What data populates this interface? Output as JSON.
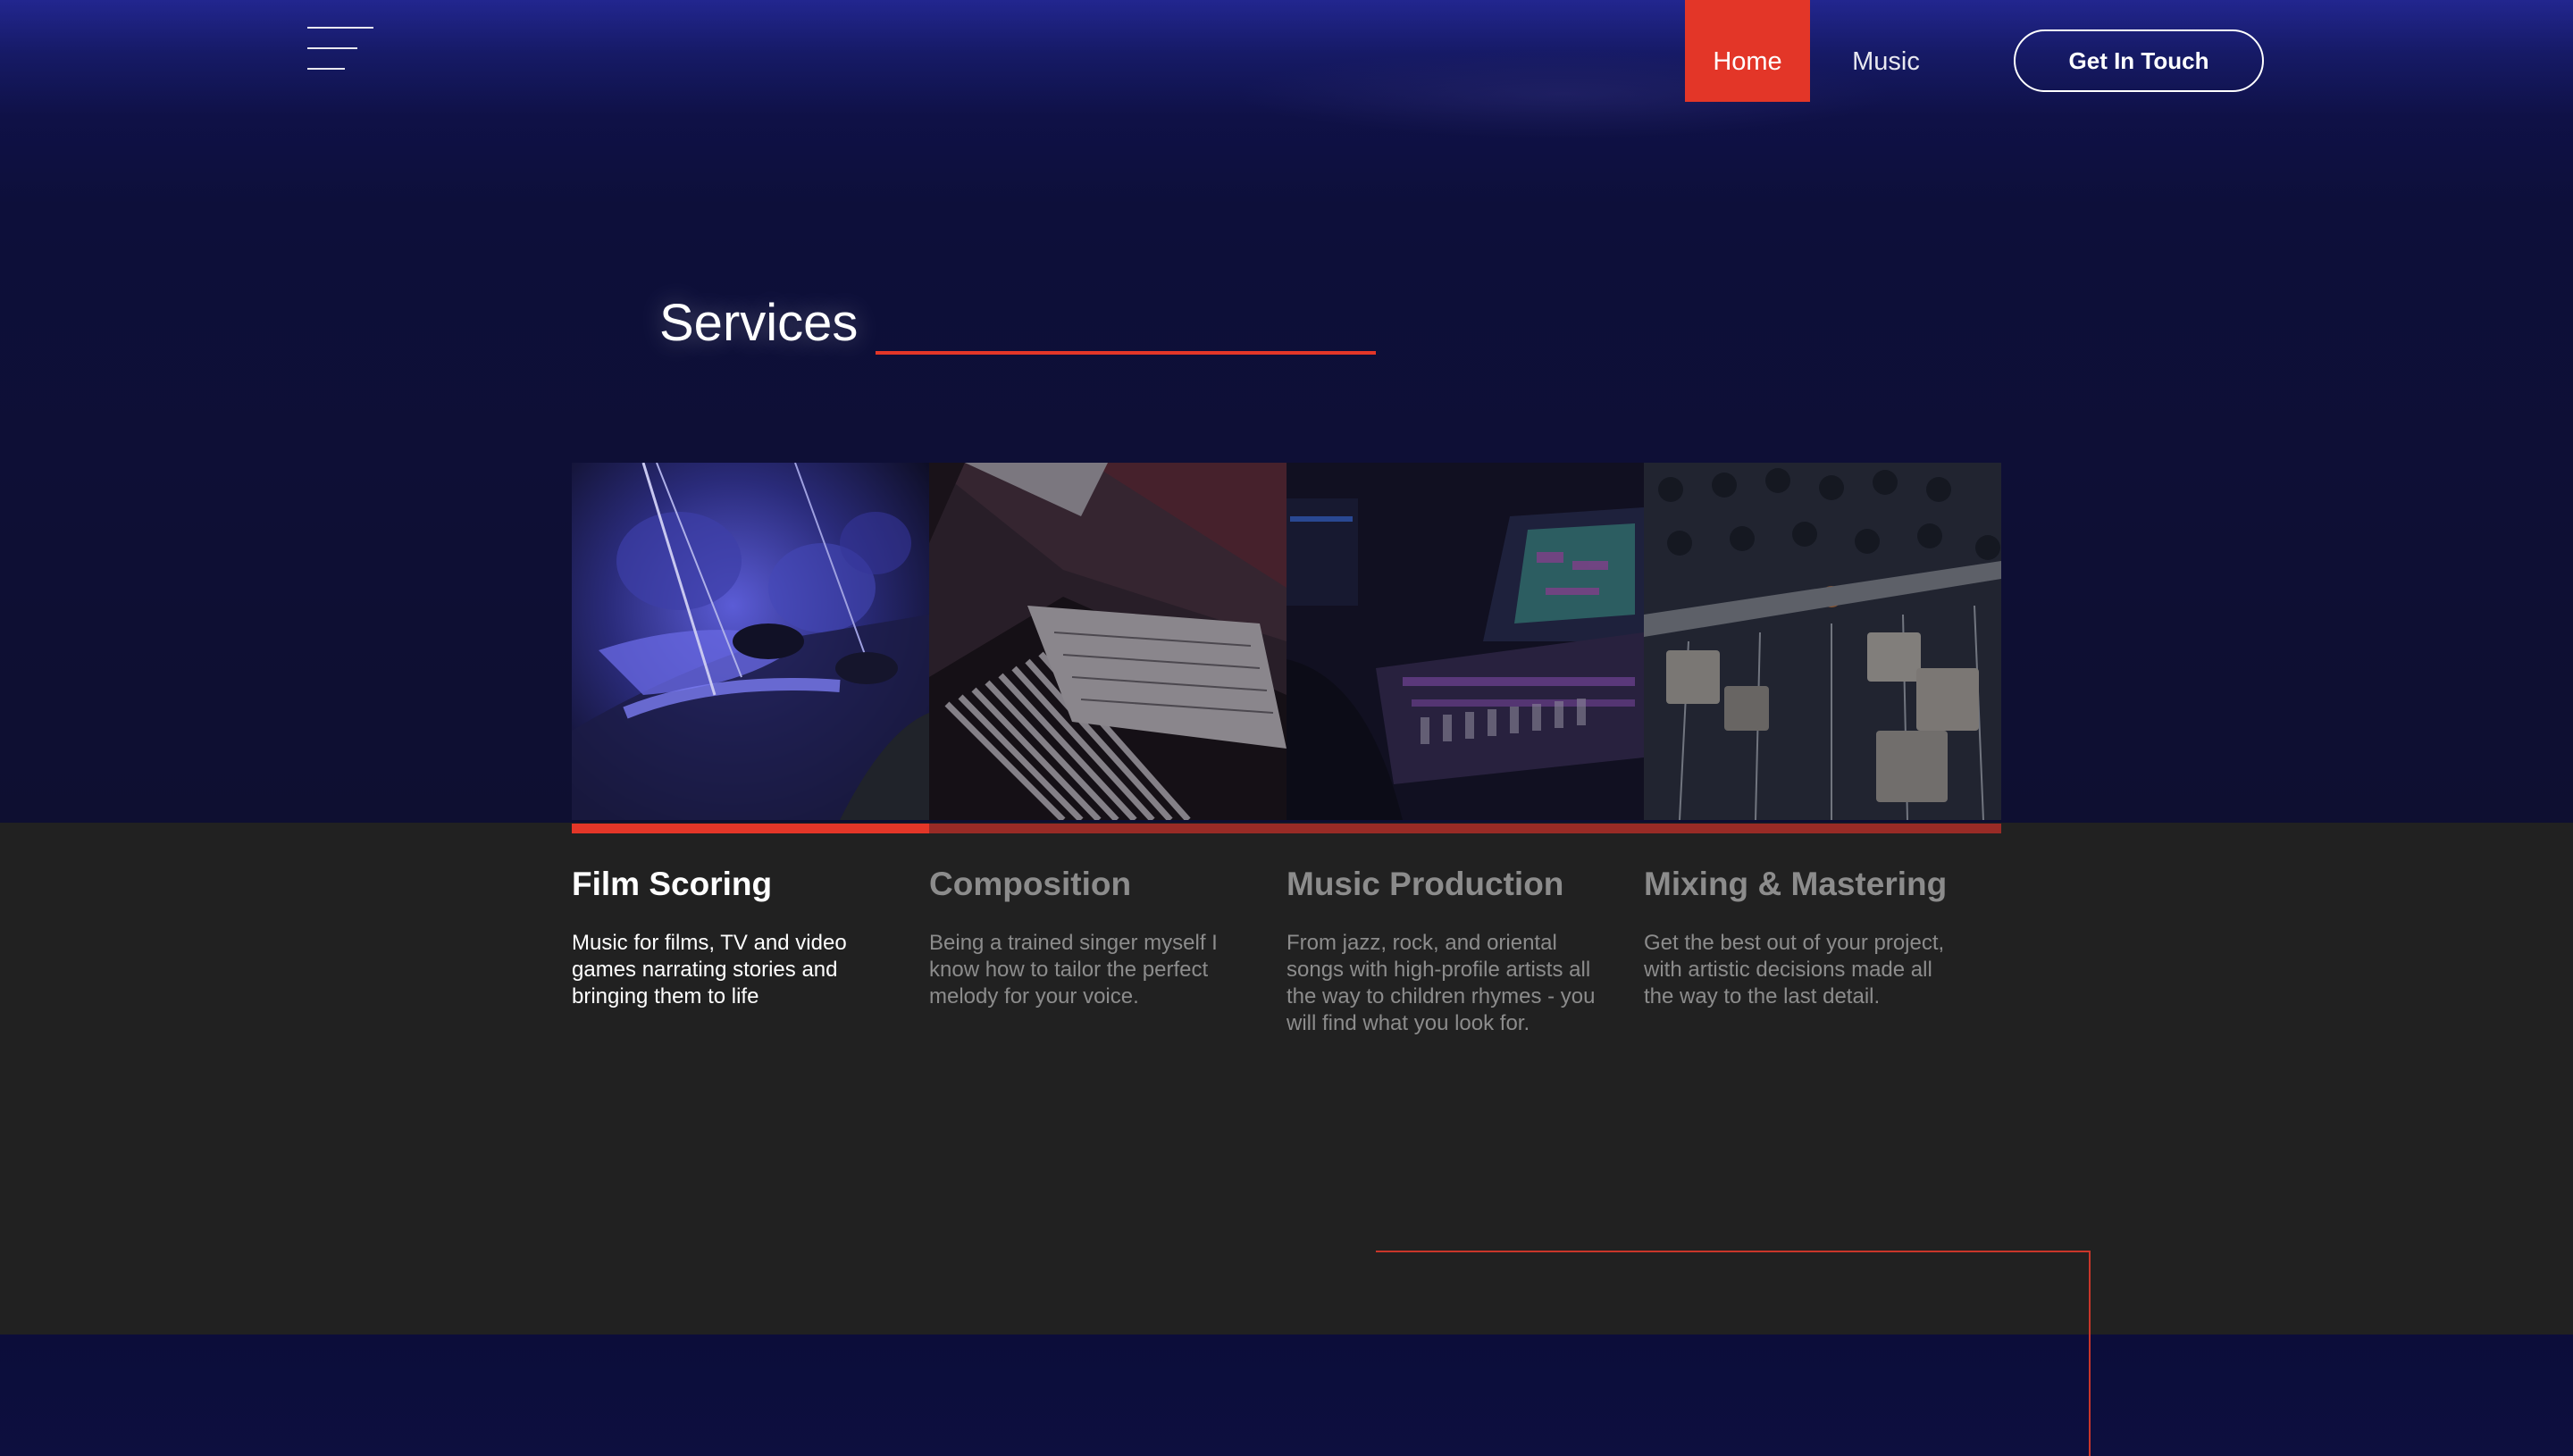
{
  "header": {
    "nav": [
      {
        "label": "Home",
        "active": true
      },
      {
        "label": "Music",
        "active": false
      }
    ],
    "cta_label": "Get In Touch"
  },
  "services": {
    "title": "Services",
    "cards": [
      {
        "title": "Film Scoring",
        "description": "Music for films, TV and video games narrating stories and bringing them to life",
        "image_icon": "orchestra-violins-photo",
        "active": true
      },
      {
        "title": "Composition",
        "description": "Being a trained singer myself I know how to tailor the perfect melody for your voice.",
        "image_icon": "piano-sheet-music-photo",
        "active": false
      },
      {
        "title": "Music Production",
        "description": "From jazz, rock, and oriental songs with high-profile artists all the way to children rhymes - you will find what you look for.",
        "image_icon": "studio-console-photo",
        "active": false
      },
      {
        "title": "Mixing & Mastering",
        "description": "Get the best out of your project, with artistic decisions made all the way to the last detail.",
        "image_icon": "mixing-faders-photo",
        "active": false
      }
    ]
  },
  "colors": {
    "accent": "#e33628",
    "accent_dim": "#992b26",
    "hero_bg": "#0e0f33",
    "section_bg": "#212121",
    "muted_text": "#8c8c8c"
  }
}
